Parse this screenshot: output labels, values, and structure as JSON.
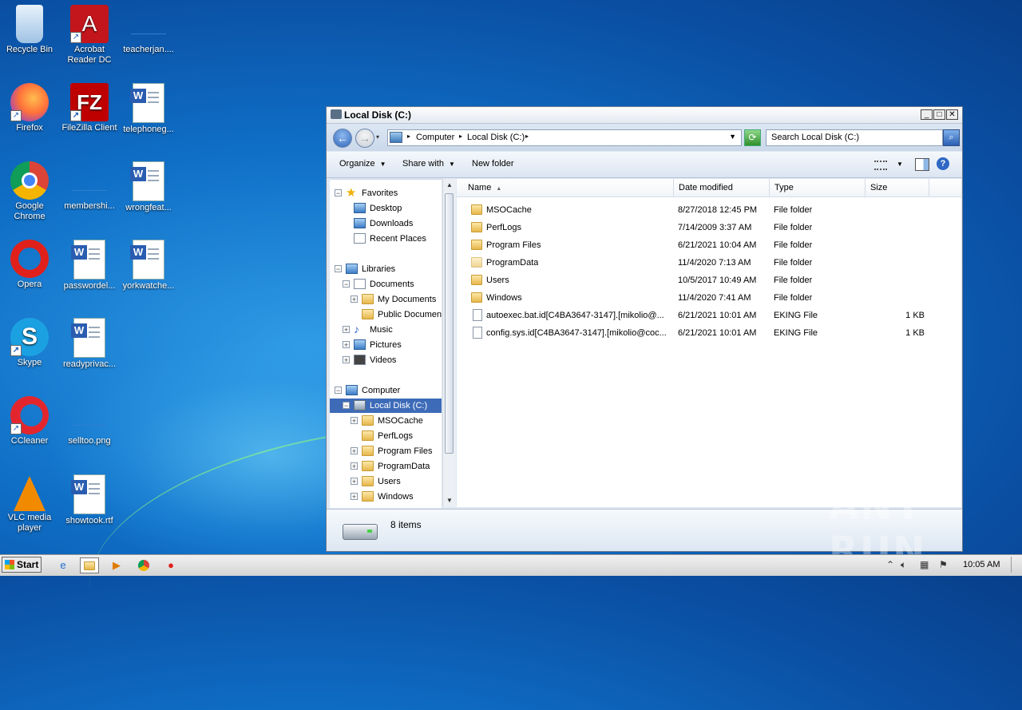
{
  "desktop": {
    "icons": [
      {
        "label": "Recycle Bin"
      },
      {
        "label": "Acrobat Reader DC"
      },
      {
        "label": "teacherjan...."
      },
      {
        "label": "Firefox"
      },
      {
        "label": "FileZilla Client"
      },
      {
        "label": "telephoneg..."
      },
      {
        "label": "Google Chrome"
      },
      {
        "label": "membershi..."
      },
      {
        "label": "wrongfeat..."
      },
      {
        "label": "Opera"
      },
      {
        "label": "passwordel..."
      },
      {
        "label": "yorkwatche..."
      },
      {
        "label": "Skype"
      },
      {
        "label": "readyprivac..."
      },
      {
        "label": "CCleaner"
      },
      {
        "label": "selltoo.png"
      },
      {
        "label": "VLC media player"
      },
      {
        "label": "showtook.rtf"
      }
    ]
  },
  "window": {
    "title": "Local Disk (C:)",
    "address": {
      "crumbs": [
        "Computer",
        "Local Disk (C:)"
      ]
    },
    "search_placeholder": "Search Local Disk (C:)",
    "commands": {
      "organize": "Organize",
      "share_with": "Share with",
      "new_folder": "New folder"
    },
    "nav": {
      "favorites": "Favorites",
      "desktop": "Desktop",
      "downloads": "Downloads",
      "recent": "Recent Places",
      "libraries": "Libraries",
      "documents": "Documents",
      "my_documents": "My Documents",
      "public_documents": "Public Documents",
      "music": "Music",
      "pictures": "Pictures",
      "videos": "Videos",
      "computer": "Computer",
      "local_disk": "Local Disk (C:)",
      "msocache": "MSOCache",
      "perflogs": "PerfLogs",
      "program_files": "Program Files",
      "programdata": "ProgramData",
      "users": "Users",
      "windows": "Windows"
    },
    "columns": {
      "name": "Name",
      "date": "Date modified",
      "type": "Type",
      "size": "Size"
    },
    "files": [
      {
        "name": "MSOCache",
        "date": "8/27/2018 12:45 PM",
        "type": "File folder",
        "size": ""
      },
      {
        "name": "PerfLogs",
        "date": "7/14/2009 3:37 AM",
        "type": "File folder",
        "size": ""
      },
      {
        "name": "Program Files",
        "date": "6/21/2021 10:04 AM",
        "type": "File folder",
        "size": ""
      },
      {
        "name": "ProgramData",
        "date": "11/4/2020 7:13 AM",
        "type": "File folder",
        "size": ""
      },
      {
        "name": "Users",
        "date": "10/5/2017 10:49 AM",
        "type": "File folder",
        "size": ""
      },
      {
        "name": "Windows",
        "date": "11/4/2020 7:41 AM",
        "type": "File folder",
        "size": ""
      },
      {
        "name": "autoexec.bat.id[C4BA3647-3147].[mikolio@...",
        "date": "6/21/2021 10:01 AM",
        "type": "EKING File",
        "size": "1 KB"
      },
      {
        "name": "config.sys.id[C4BA3647-3147].[mikolio@coc...",
        "date": "6/21/2021 10:01 AM",
        "type": "EKING File",
        "size": "1 KB"
      }
    ],
    "status": {
      "count": "8 items"
    }
  },
  "taskbar": {
    "start": "Start",
    "clock": "10:05 AM"
  },
  "watermark": "ANY RUN"
}
